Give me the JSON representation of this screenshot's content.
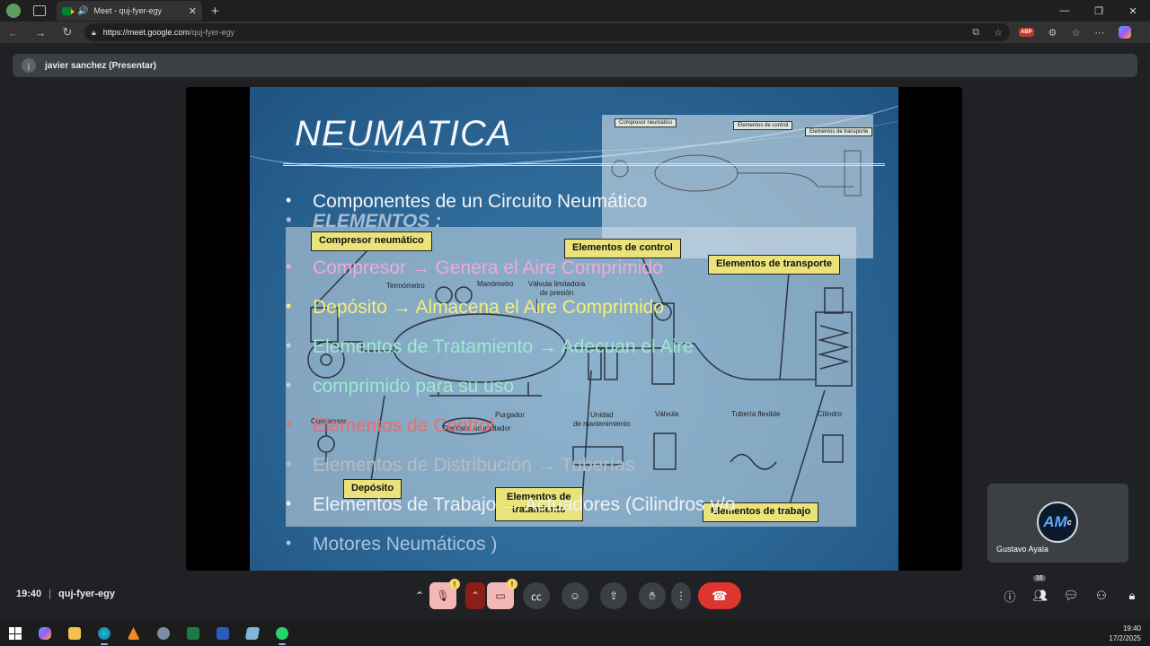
{
  "browser": {
    "tab_title": "Meet - quj-fyer-egy",
    "url_host": "https://meet.google.com",
    "url_path": "/quj-fyer-egy",
    "abp_badge": "ABP"
  },
  "meet": {
    "presenter_initial": "j",
    "presenter_label": "javier sanchez (Presentar)",
    "time": "19:40",
    "meeting_code": "quj-fyer-egy",
    "participant_tile_name": "Gustavo Ayala",
    "participant_logo_text": "AM",
    "participant_logo_sub": "c",
    "people_count": "16",
    "warning_glyph": "!"
  },
  "slide": {
    "title": "NEUMATICA",
    "bullets": {
      "b1": "Componentes de un Circuito Neumático",
      "b2": "ELEMENTOS :",
      "b3": "Compresor  →  Genera el Aire Comprimido",
      "b4": "Depósito  →  Almacena el Aire Comprimido",
      "b5": "Elementos   de   Tratamiento  →  Adecuan  el  Aire",
      "b5b": "comprimido para su uso",
      "b6": "Elementos de Control",
      "b7": "Elementos de Distribución → Tuberías",
      "b8": "Elementos   de   Trabajo  →  Actuadores  (Cilindros  y/o",
      "b8b": "Motores Neumáticos )"
    },
    "diagram": {
      "compresor_neumatico": "Compresor neumático",
      "elementos_control": "Elementos de control",
      "elementos_transporte": "Elementos de transporte",
      "termometro": "Termómetro",
      "manometro": "Manómetro",
      "valvula_limitadora": "Válvula limitadora\nde presión",
      "compresor": "Compresor",
      "purgador": "Purgador",
      "deposito_acumulador": "Depósito acumulador",
      "unidad_mantenimiento": "Unidad\nde mantenimiento",
      "valvula": "Válvula",
      "tuberia_flexible": "Tubería flexible",
      "cilindro": "Cilindro",
      "deposito": "Depósito",
      "elementos_tratamiento": "Elementos de\ntratamiento",
      "elementos_trabajo": "Elementos de trabajo"
    },
    "thumb": {
      "compresor": "Compresor neumático",
      "control": "Elementos de control",
      "transporte": "Elementos de transporte"
    }
  },
  "taskbar": {
    "time": "19:40",
    "date": "17/2/2025"
  },
  "colors": {
    "end_call": "#dc362e",
    "slide_blue": "#2d6896",
    "label_yellow": "#e9e37a"
  }
}
